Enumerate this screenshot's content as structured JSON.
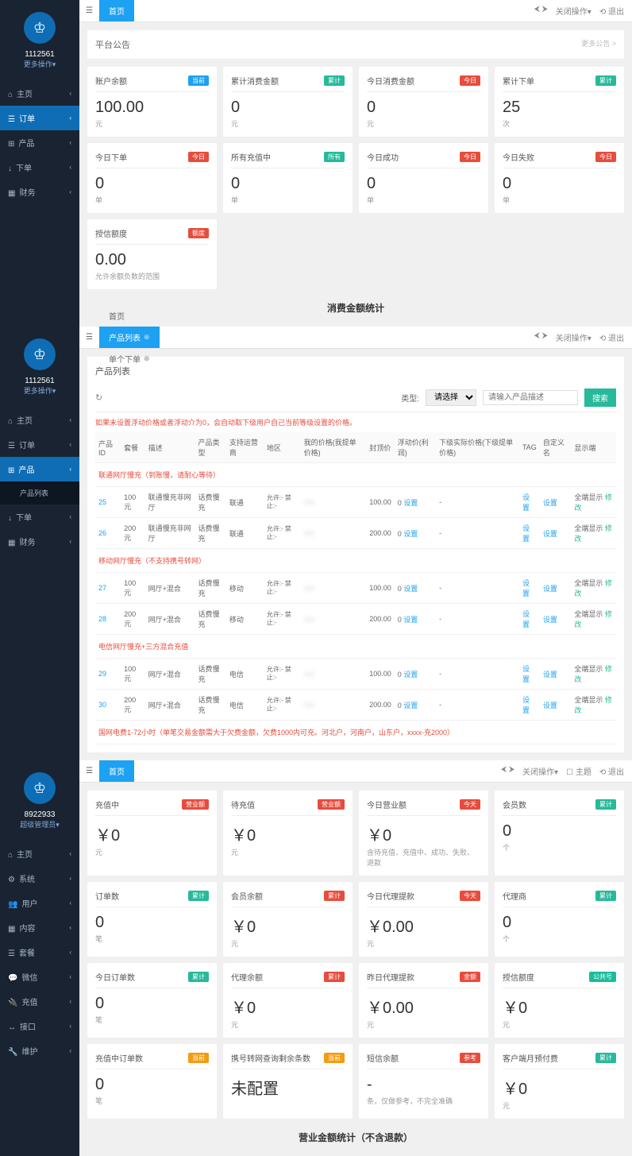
{
  "panel1": {
    "uid": "1112561",
    "more": "更多操作▾",
    "nav": [
      {
        "icon": "⌂",
        "label": "主页"
      },
      {
        "icon": "☰",
        "label": "订单",
        "active": true
      },
      {
        "icon": "⊞",
        "label": "产品"
      },
      {
        "icon": "↓",
        "label": "下单"
      },
      {
        "icon": "▦",
        "label": "财务"
      }
    ],
    "topbar": {
      "tab": "首页",
      "close": "关闭操作▾",
      "logout": "⟲ 退出",
      "arrows": "⮜ ⮞"
    },
    "notice": {
      "title": "平台公告",
      "more": "更多公告 >"
    },
    "cards": [
      {
        "t": "账户余额",
        "b": "当前",
        "bc": "b-blue",
        "v": "100.00",
        "u": "元"
      },
      {
        "t": "累计消费金额",
        "b": "累计",
        "bc": "b-green",
        "v": "0",
        "u": "元"
      },
      {
        "t": "今日消费金额",
        "b": "今日",
        "bc": "b-red",
        "v": "0",
        "u": "元"
      },
      {
        "t": "累计下单",
        "b": "累计",
        "bc": "b-green",
        "v": "25",
        "u": "次"
      },
      {
        "t": "今日下单",
        "b": "今日",
        "bc": "b-red",
        "v": "0",
        "u": "单"
      },
      {
        "t": "所有充值中",
        "b": "所有",
        "bc": "b-green",
        "v": "0",
        "u": "单"
      },
      {
        "t": "今日成功",
        "b": "今日",
        "bc": "b-red",
        "v": "0",
        "u": "单"
      },
      {
        "t": "今日失败",
        "b": "今日",
        "bc": "b-red",
        "v": "0",
        "u": "单"
      },
      {
        "t": "授信额度",
        "b": "额度",
        "bc": "b-red",
        "v": "0.00",
        "u": "允许余额负数的范围"
      }
    ],
    "section": "消费金额统计"
  },
  "panel2": {
    "uid": "1112561",
    "more": "更多操作▾",
    "nav": [
      {
        "icon": "⌂",
        "label": "主页"
      },
      {
        "icon": "☰",
        "label": "订单"
      },
      {
        "icon": "⊞",
        "label": "产品",
        "active": true
      },
      {
        "icon": "",
        "label": "产品列表",
        "sub": true
      },
      {
        "icon": "↓",
        "label": "下单"
      },
      {
        "icon": "▦",
        "label": "财务"
      }
    ],
    "tabs": [
      "首页",
      "产品列表",
      "单个下单"
    ],
    "topbar": {
      "close": "关闭操作▾",
      "logout": "⟲ 退出",
      "arrows": "⮜ ⮞"
    },
    "box_title": "产品列表",
    "toolbar": {
      "refresh": "↻",
      "type_label": "类型:",
      "type_value": "请选择",
      "search_ph": "请输入产品描述",
      "search_btn": "搜索"
    },
    "tip": "如果未设置浮动价格或者浮动介为0，会自动取下级用户自己当前等级设置的价格。",
    "headers": [
      "产品ID",
      "套餐",
      "描述",
      "产品类型",
      "支持运营商",
      "地区",
      "我的价格(我提单价格)",
      "封顶价",
      "浮动价(利润)",
      "下级实际价格(下级提单价格)",
      "TAG",
      "自定义名",
      "显示端"
    ],
    "groups": [
      {
        "name": "联通网厅慢充（到账慢，请耐心等待）",
        "rows": [
          {
            "id": "25",
            "pkg": "100元",
            "desc": "联通慢充非网厅",
            "type": "话费慢充",
            "op": "联通",
            "area": "允许:- 禁止:-",
            "my": "xxx",
            "cap": "100.00",
            "float": "0 设置",
            "down": "-",
            "tag": "设置",
            "cname": "设置",
            "disp": "全端显示 修改"
          },
          {
            "id": "26",
            "pkg": "200元",
            "desc": "联通慢充非网厅",
            "type": "话费慢充",
            "op": "联通",
            "area": "允许:- 禁止:-",
            "my": "xxx",
            "cap": "200.00",
            "float": "0 设置",
            "down": "-",
            "tag": "设置",
            "cname": "设置",
            "disp": "全端显示 修改"
          }
        ]
      },
      {
        "name": "移动网厅慢充（不支持携号转网）",
        "rows": [
          {
            "id": "27",
            "pkg": "100元",
            "desc": "网厅+混合",
            "type": "话费慢充",
            "op": "移动",
            "area": "允许:- 禁止:-",
            "my": "xxx",
            "cap": "100.00",
            "float": "0 设置",
            "down": "-",
            "tag": "设置",
            "cname": "设置",
            "disp": "全端显示 修改"
          },
          {
            "id": "28",
            "pkg": "200元",
            "desc": "网厅+混合",
            "type": "话费慢充",
            "op": "移动",
            "area": "允许:- 禁止:-",
            "my": "xxx",
            "cap": "200.00",
            "float": "0 设置",
            "down": "-",
            "tag": "设置",
            "cname": "设置",
            "disp": "全端显示 修改"
          }
        ]
      },
      {
        "name": "电信网厅慢充+三方混合充值",
        "rows": [
          {
            "id": "29",
            "pkg": "100元",
            "desc": "网厅+混合",
            "type": "话费慢充",
            "op": "电信",
            "area": "允许:- 禁止:-",
            "my": "xxx",
            "cap": "100.00",
            "float": "0 设置",
            "down": "-",
            "tag": "设置",
            "cname": "设置",
            "disp": "全端显示 修改"
          },
          {
            "id": "30",
            "pkg": "200元",
            "desc": "网厅+混合",
            "type": "话费慢充",
            "op": "电信",
            "area": "允许:- 禁止:-",
            "my": "xxx",
            "cap": "200.00",
            "float": "0 设置",
            "down": "-",
            "tag": "设置",
            "cname": "设置",
            "disp": "全端显示 修改"
          }
        ]
      },
      {
        "name": "国网电费1-72小时（单笔交易金额需大于欠费金额，欠费1000内可充。河北户，河南户，山东户，xxxx-充2000）",
        "rows": []
      }
    ]
  },
  "panel3": {
    "uid": "8922933",
    "more": "超级管理员▾",
    "nav": [
      {
        "icon": "⌂",
        "label": "主页"
      },
      {
        "icon": "⚙",
        "label": "系统"
      },
      {
        "icon": "👥",
        "label": "用户"
      },
      {
        "icon": "▦",
        "label": "内容"
      },
      {
        "icon": "☰",
        "label": "套餐"
      },
      {
        "icon": "💬",
        "label": "微信"
      },
      {
        "icon": "🔌",
        "label": "充值"
      },
      {
        "icon": "↔",
        "label": "接口"
      },
      {
        "icon": "🔧",
        "label": "维护"
      }
    ],
    "topbar": {
      "tab": "首页",
      "close": "关闭操作▾",
      "theme": "☐ 主题",
      "logout": "⟲ 退出",
      "arrows": "⮜ ⮞"
    },
    "cards": [
      {
        "t": "充值中",
        "b": "营业额",
        "bc": "b-red",
        "v": "￥0",
        "u": "元"
      },
      {
        "t": "待充值",
        "b": "营业额",
        "bc": "b-red",
        "v": "￥0",
        "u": "元"
      },
      {
        "t": "今日营业额",
        "b": "今天",
        "bc": "b-red",
        "v": "￥0",
        "u": "含待充值、充值中、成功、失败、退款"
      },
      {
        "t": "会员数",
        "b": "累计",
        "bc": "b-green",
        "v": "0",
        "u": "个"
      },
      {
        "t": "订单数",
        "b": "累计",
        "bc": "b-green",
        "v": "0",
        "u": "笔"
      },
      {
        "t": "会员余额",
        "b": "累计",
        "bc": "b-red",
        "v": "￥0",
        "u": "元"
      },
      {
        "t": "今日代理提款",
        "b": "今天",
        "bc": "b-red",
        "v": "￥0.00",
        "u": "元"
      },
      {
        "t": "代理商",
        "b": "累计",
        "bc": "b-green",
        "v": "0",
        "u": "个"
      },
      {
        "t": "今日订单数",
        "b": "累计",
        "bc": "b-green",
        "v": "0",
        "u": "笔"
      },
      {
        "t": "代理余额",
        "b": "累计",
        "bc": "b-red",
        "v": "￥0",
        "u": "元"
      },
      {
        "t": "昨日代理提款",
        "b": "金额",
        "bc": "b-red",
        "v": "￥0.00",
        "u": "元"
      },
      {
        "t": "授信额度",
        "b": "公共号",
        "bc": "b-teal",
        "v": "￥0",
        "u": "元"
      },
      {
        "t": "充值中订单数",
        "b": "当前",
        "bc": "b-orange",
        "v": "0",
        "u": "笔"
      },
      {
        "t": "携号转网查询剩余条数",
        "b": "当前",
        "bc": "b-orange",
        "v": "未配置",
        "u": ""
      },
      {
        "t": "短信余额",
        "b": "参考",
        "bc": "b-red",
        "v": "-",
        "u": "条，仅做参考，不完全准确"
      },
      {
        "t": "客户端月预付费",
        "b": "累计",
        "bc": "b-green",
        "v": "￥0",
        "u": "元"
      }
    ],
    "section": "营业金额统计（不含退款）"
  }
}
